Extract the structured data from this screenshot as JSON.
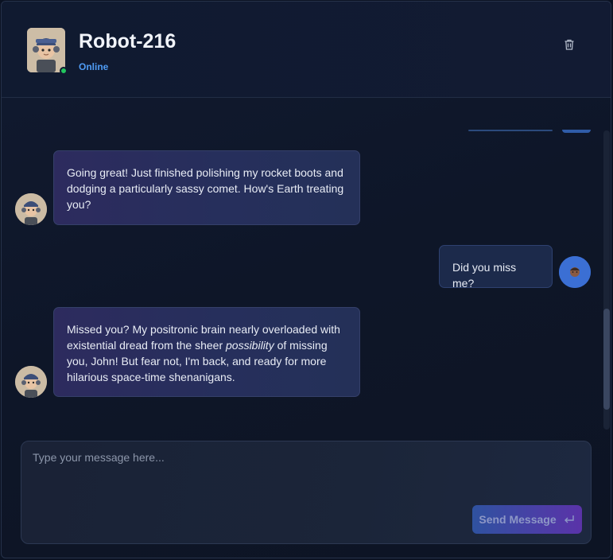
{
  "header": {
    "bot_name": "Robot-216",
    "status": "Online",
    "delete_icon": "trash-icon"
  },
  "messages": [
    {
      "sender": "bot",
      "avatar": "robot-avatar",
      "text": "Going great! Just finished polishing my rocket boots and dodging a particularly sassy comet. How's Earth treating you?"
    },
    {
      "sender": "user",
      "avatar": "user-avatar",
      "text": "Did you miss me?"
    },
    {
      "sender": "bot",
      "avatar": "robot-avatar",
      "text_before": "Missed you?  My positronic brain nearly overloaded with existential dread from the sheer ",
      "text_emphasis": "possibility",
      "text_after": " of missing you, John!  But fear not, I'm back, and ready for more hilarious space-time shenanigans."
    }
  ],
  "composer": {
    "placeholder": "Type your message here...",
    "value": "",
    "send_label": "Send Message",
    "send_icon": "enter-icon"
  },
  "colors": {
    "accent": "#4f9cf5",
    "online": "#22c55e",
    "background": "#0e1628"
  }
}
